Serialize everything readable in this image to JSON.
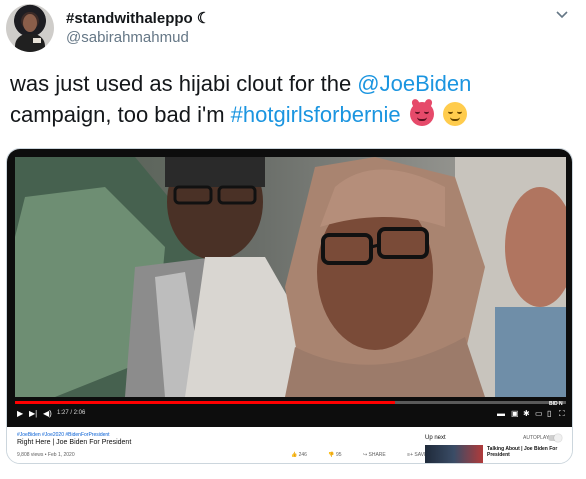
{
  "author": {
    "display_name": "#standwithaleppo ☾",
    "handle": "@sabirahmahmud"
  },
  "tweet": {
    "line1_text": "was just used as hijabi clout for the ",
    "line1_mention": "@JoeBiden",
    "line2_text": " campaign, too bad i'm ",
    "line2_hashtag": "#hotgirlsforbernie",
    "emojis": [
      "smiling-face-with-horns-emoji",
      "relieved-face-emoji"
    ]
  },
  "video": {
    "time": "1:27 / 2:06",
    "progress_fraction": 0.69,
    "brand_mark": "BID N",
    "tags": "#JoeBiden #Joe2020 #BidenForPresident",
    "title": "Right Here | Joe Biden For President",
    "meta": "9,808 views • Feb 1, 2020",
    "likes": "246",
    "dislikes": "95",
    "share_label": "SHARE",
    "save_label": "SAVE",
    "up_next_label": "Up next",
    "autoplay_label": "AUTOPLAY",
    "next_title": "Talking About | Joe Biden For President"
  },
  "colors": {
    "link": "#1b95e0",
    "progress": "#ff0000"
  }
}
